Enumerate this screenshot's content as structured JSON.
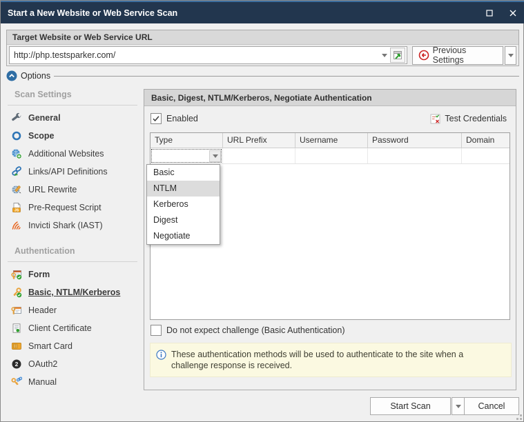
{
  "window": {
    "title": "Start a New Website or Web Service Scan"
  },
  "colors": {
    "titlebar_bg": "#22364e",
    "accent_blue": "#2e6da4",
    "gold_key": "#e8a33d",
    "info_box_bg": "#fbf9e1",
    "dropdown_highlight": "#dcdcdc",
    "shark_orange": "#e8651f",
    "previous_settings_red": "#cc2222",
    "green_badge": "#3aa13a"
  },
  "target": {
    "group_title": "Target Website or Web Service URL",
    "url_value": "http://php.testsparker.com/",
    "url_dropdown_icon": "chevron-down-icon",
    "open_in_browser_icon": "window-green-arrow-icon",
    "previous_settings_label": "Previous Settings",
    "previous_settings_icon": "red-back-arrow-icon"
  },
  "options": {
    "label": "Options",
    "collapse_icon": "chevron-up-circle-icon"
  },
  "sidebar": {
    "scan_settings": {
      "header": "Scan Settings",
      "items": [
        {
          "label": "General",
          "icon": "wrench-icon"
        },
        {
          "label": "Scope",
          "icon": "scope-ring-icon"
        },
        {
          "label": "Additional Websites",
          "icon": "globe-plus-icon"
        },
        {
          "label": "Links/API Definitions",
          "icon": "link-arrow-icon"
        },
        {
          "label": "URL Rewrite",
          "icon": "globe-pencil-icon"
        },
        {
          "label": "Pre-Request Script",
          "icon": "script-js-icon"
        },
        {
          "label": "Invicti Shark (IAST)",
          "icon": "shark-waves-icon"
        }
      ]
    },
    "authentication": {
      "header": "Authentication",
      "items": [
        {
          "label": "Form",
          "icon": "form-key-check-icon"
        },
        {
          "label": "Basic, NTLM/Kerberos",
          "icon": "key-check-icon"
        },
        {
          "label": "Header",
          "icon": "key-window-icon"
        },
        {
          "label": "Client Certificate",
          "icon": "certificate-icon"
        },
        {
          "label": "Smart Card",
          "icon": "smart-card-icon"
        },
        {
          "label": "OAuth2",
          "icon": "oauth2-icon"
        },
        {
          "label": "Manual",
          "icon": "key-chain-icon"
        }
      ]
    }
  },
  "panel": {
    "title": "Basic, Digest, NTLM/Kerberos, Negotiate Authentication",
    "enabled_label": "Enabled",
    "enabled_checked": true,
    "test_credentials_label": "Test Credentials",
    "test_credentials_icon": "checklist-check-x-icon",
    "table": {
      "columns": [
        "Type",
        "URL Prefix",
        "Username",
        "Password",
        "Domain"
      ],
      "rows": [
        {
          "type": "",
          "url_prefix": "",
          "username": "",
          "password": "",
          "domain": ""
        }
      ]
    },
    "type_dropdown": {
      "options": [
        "Basic",
        "NTLM",
        "Kerberos",
        "Digest",
        "Negotiate"
      ],
      "highlighted": "NTLM"
    },
    "challenge_checkbox_label": "Do not expect challenge (Basic Authentication)",
    "challenge_checkbox_checked": false,
    "info_icon": "info-circle-icon",
    "info_text": "These authentication methods will be used to authenticate to the site when a challenge response is received."
  },
  "footer": {
    "start_scan_label": "Start Scan",
    "cancel_label": "Cancel"
  }
}
